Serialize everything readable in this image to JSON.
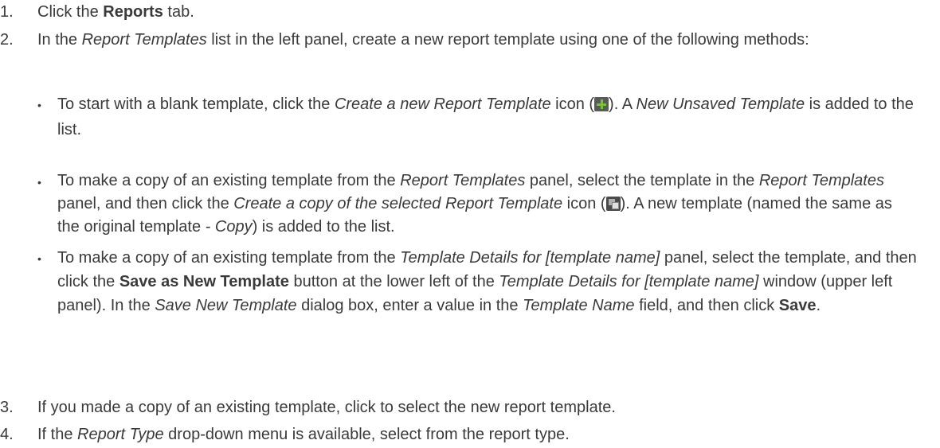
{
  "steps": [
    {
      "num": "1.",
      "parts": [
        "Click the ",
        "Reports",
        " tab."
      ]
    },
    {
      "num": "2.",
      "parts": [
        "In the ",
        "Report Templates",
        " list in the left panel, create a new report template using one of the following methods:"
      ],
      "bullets": [
        {
          "parts": [
            "To start with a blank template, click the ",
            "Create a new Report Template",
            " icon (",
            "). A ",
            "New Unsaved Template",
            " is added to the list."
          ],
          "icon": "plus-icon"
        },
        {
          "parts": [
            "To make a copy of an existing template from the ",
            "Report Templates",
            " panel, select the template in the ",
            "Report Templates",
            " panel, and then click the ",
            "Create a copy of the selected Report Template",
            " icon (",
            "). A new template (named the same as the original template ",
            "- Copy",
            ") is added to the list."
          ],
          "icon": "copy-icon"
        },
        {
          "parts": [
            "To make a copy of an existing template from the ",
            "Template Details for [template name]",
            " panel, select the template, and then click the ",
            "Save as New Template",
            " button at the lower left of the ",
            "Template Details for [template name]",
            " window (upper left panel). In the ",
            "Save New Template",
            " dialog box, enter a value in the ",
            "Template Name",
            " field, and then click ",
            "Save",
            "."
          ]
        }
      ]
    },
    {
      "num": "3.",
      "parts": [
        "If you made a copy of an existing template, click to select the new report template."
      ]
    },
    {
      "num": "4.",
      "parts": [
        "If the ",
        "Report Type",
        " drop-down menu is available, select from the report type."
      ]
    }
  ],
  "bullet_glyph": "•"
}
